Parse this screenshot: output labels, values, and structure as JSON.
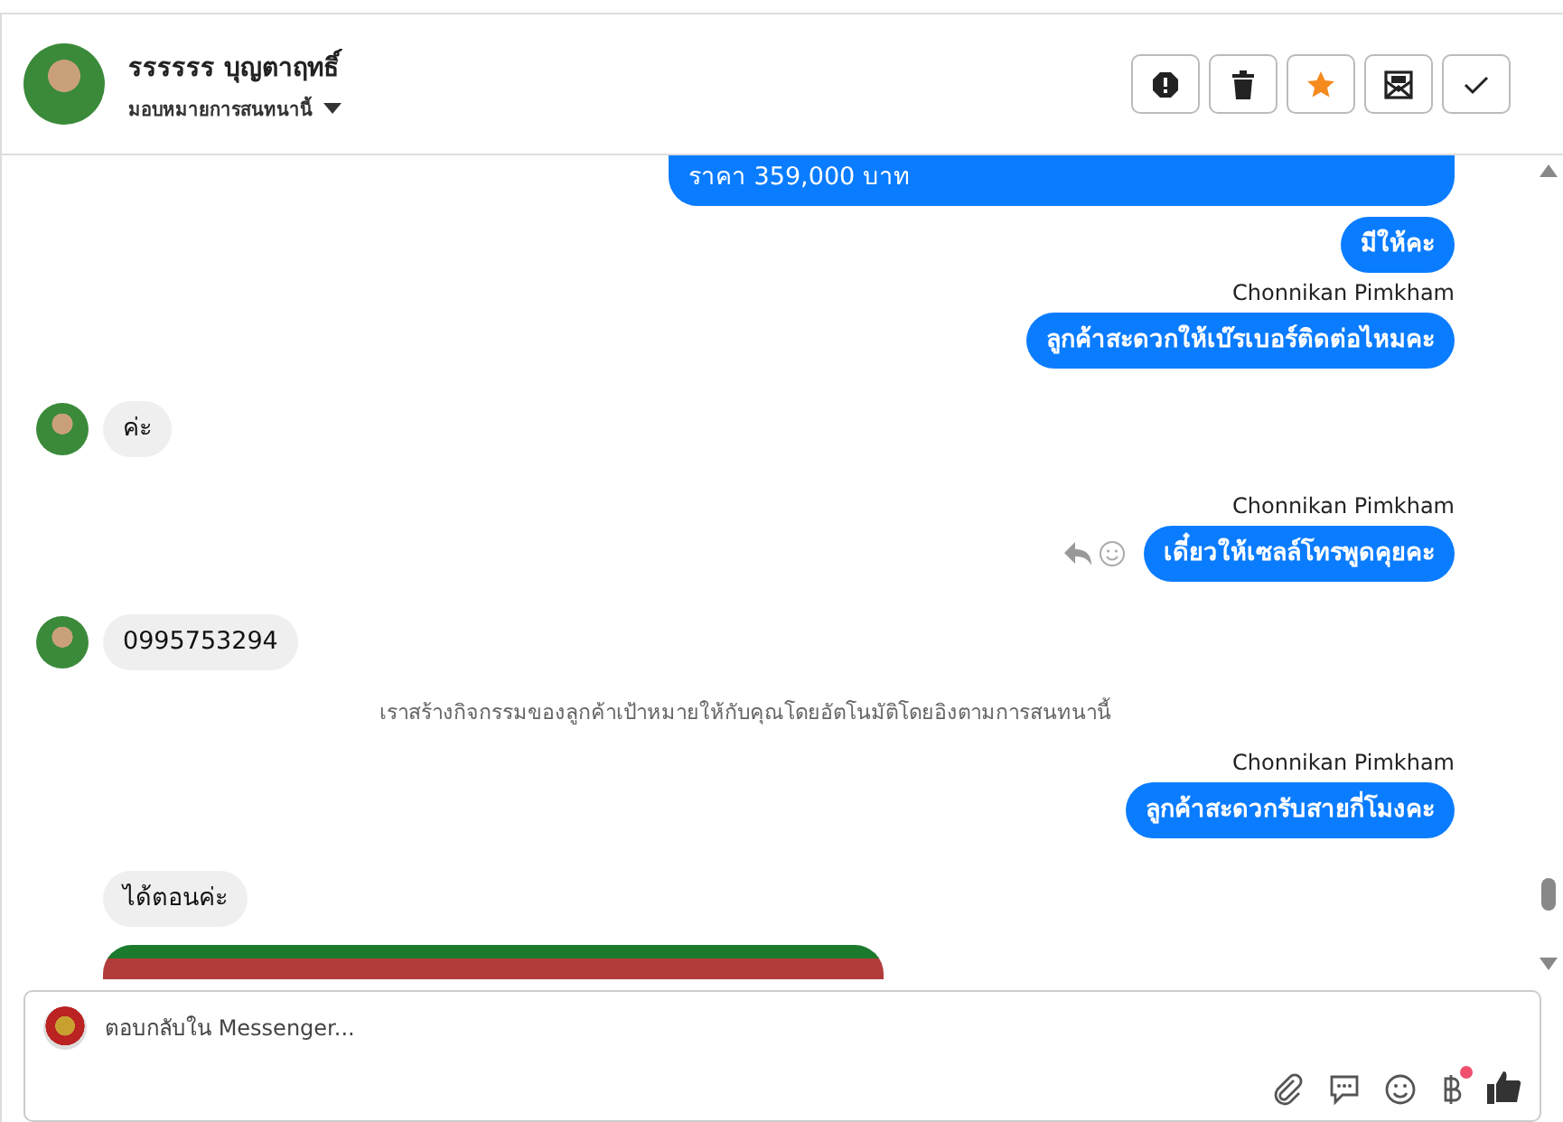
{
  "header": {
    "name": "รรรรรร บุญตาฤทธิ์",
    "assign_label": "มอบหมายการสนทนานี้",
    "actions": [
      {
        "kind": "spam",
        "on": false
      },
      {
        "kind": "delete",
        "on": false
      },
      {
        "kind": "star",
        "on": true
      },
      {
        "kind": "unread",
        "on": false
      },
      {
        "kind": "done",
        "on": false
      }
    ]
  },
  "messages": [
    {
      "kind": "outgoing",
      "text": "ราคา 359,000 บาท",
      "actions": false
    },
    {
      "kind": "outgoing",
      "text": "มีให้คะ",
      "actions": false
    },
    {
      "kind": "sender",
      "text": "Chonnikan Pimkham"
    },
    {
      "kind": "outgoing",
      "text": "ลูกค้าสะดวกให้เบ๊รเบอร์ติดต่อไหมคะ",
      "actions": false
    },
    {
      "kind": "incoming",
      "text": "ค่ะ",
      "avatar": true
    },
    {
      "kind": "sender",
      "text": "Chonnikan Pimkham"
    },
    {
      "kind": "outgoing",
      "text": "เดี๋ยวให้เซลล์โทรพูดคุยคะ",
      "actions": true
    },
    {
      "kind": "incoming",
      "text": "0995753294",
      "avatar": true
    },
    {
      "kind": "system",
      "text": "เราสร้างกิจกรรมของลูกค้าเป้าหมายให้กับคุณโดยอัตโนมัติโดยอิงตามการสนทนานี้"
    },
    {
      "kind": "sender",
      "text": "Chonnikan Pimkham"
    },
    {
      "kind": "outgoing",
      "text": "ลูกค้าสะดวกรับสายกี่โมงคะ",
      "actions": false
    },
    {
      "kind": "incoming",
      "text": "ได้ตอนค่ะ",
      "avatar": false
    },
    {
      "kind": "image"
    }
  ],
  "composer": {
    "placeholder": "ตอบกลับใน Messenger...",
    "tools": [
      {
        "kind": "attach",
        "badge": false
      },
      {
        "kind": "reply",
        "badge": false
      },
      {
        "kind": "emoji",
        "badge": false
      },
      {
        "kind": "baht",
        "badge": true
      },
      {
        "kind": "like",
        "badge": false
      }
    ]
  }
}
